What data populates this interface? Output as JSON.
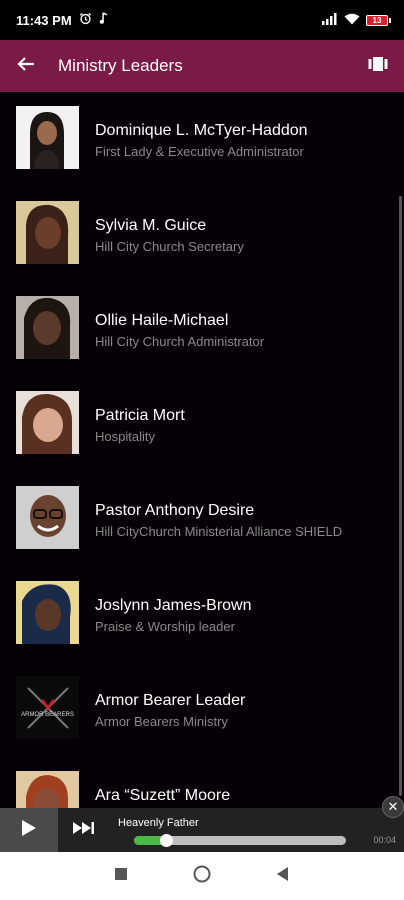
{
  "status": {
    "time": "11:43 PM",
    "battery": "13"
  },
  "app_bar": {
    "title": "Ministry Leaders"
  },
  "leaders": [
    {
      "name": "Dominique L. McTyer-Haddon",
      "role": "First Lady & Executive Administrator",
      "photo": "#3a2a22"
    },
    {
      "name": "Sylvia M. Guice",
      "role": "Hill City Church Secretary",
      "photo": "#5a3a2a"
    },
    {
      "name": "Ollie Haile-Michael",
      "role": "Hill City Church Administrator",
      "photo": "#4a3026"
    },
    {
      "name": "Patricia Mort",
      "role": "Hospitality",
      "photo": "#8a6a5a"
    },
    {
      "name": "Pastor Anthony Desire",
      "role": "Hill CityChurch Ministerial Alliance SHIELD",
      "photo": "#5a3a2c"
    },
    {
      "name": "Joslynn James-Brown",
      "role": "Praise & Worship leader",
      "photo": "#3a2a30"
    },
    {
      "name": "Armor Bearer Leader",
      "role": "Armor Bearers Ministry",
      "photo": "#111111"
    },
    {
      "name": "Ara “Suzett” Moore",
      "role": "",
      "photo": "#a05a40"
    }
  ],
  "player": {
    "track": "Heavenly Father",
    "time": "00:04",
    "progress": 0.15
  },
  "colors": {
    "app_bar": "#7a1a46",
    "progress_fill": "#4cb848"
  }
}
